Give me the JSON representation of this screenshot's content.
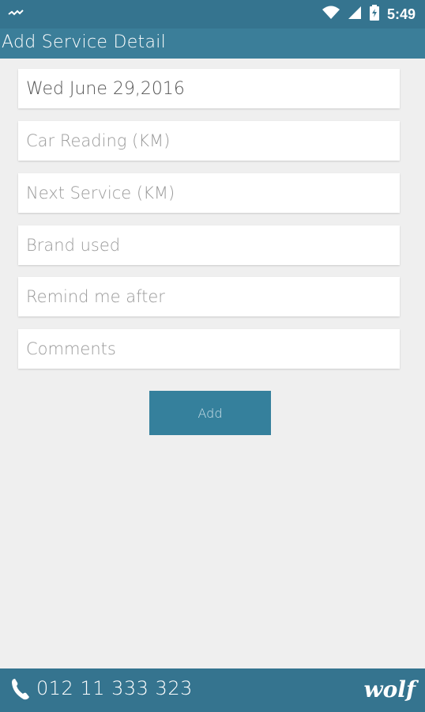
{
  "status_bar": {
    "time": "5:49",
    "notification_icon": "wolf-notification-icon",
    "wifi_icon": "wifi-icon",
    "signal_icon": "signal-icon",
    "battery_icon": "battery-charging-icon"
  },
  "app_bar": {
    "title": "Add Service Detail"
  },
  "form": {
    "date_value": "Wed June 29,2016",
    "car_reading_placeholder": "Car Reading (KM)",
    "next_service_placeholder": "Next Service (KM)",
    "brand_used_placeholder": "Brand used",
    "remind_me_placeholder": "Remind me after",
    "comments_placeholder": "Comments",
    "add_label": "Add"
  },
  "footer": {
    "phone_icon": "phone-icon",
    "phone_number": "012 11 333 323",
    "logo_text": "wolf"
  }
}
